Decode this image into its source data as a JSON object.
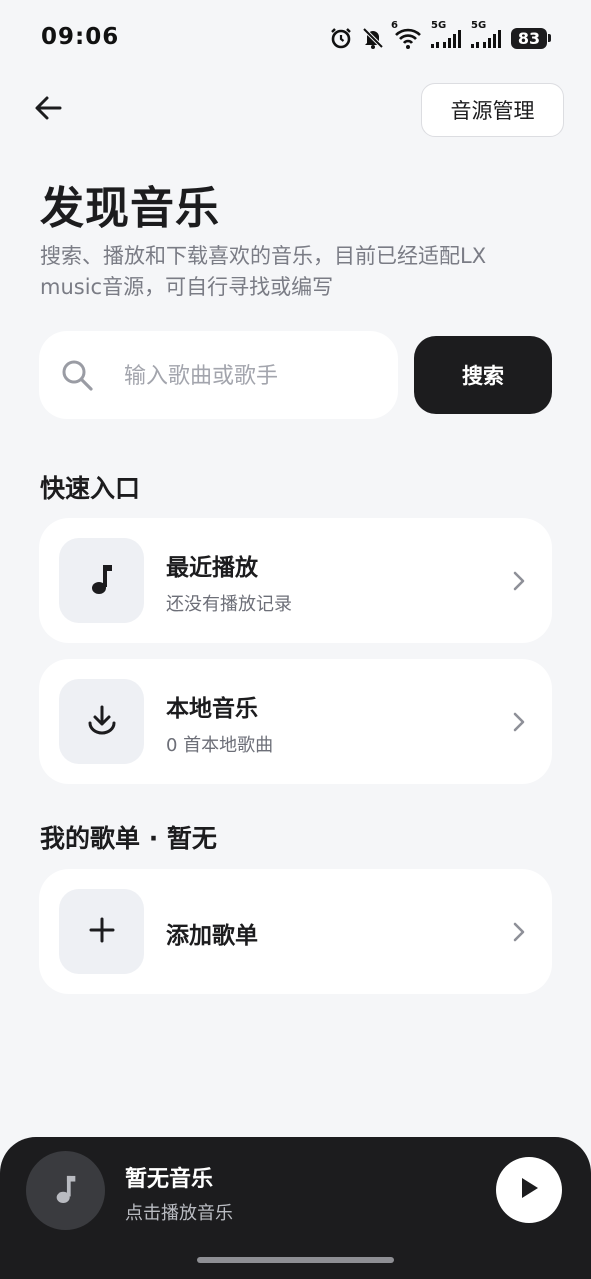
{
  "status_bar": {
    "time": "09:06",
    "battery": "83",
    "network_label_1": "5G",
    "network_label_2": "5G",
    "wifi_label": "6",
    "icons": [
      "alarm-icon",
      "bell-off-icon",
      "wifi-icon",
      "signal-icon",
      "signal-icon",
      "battery-icon"
    ]
  },
  "header": {
    "back_icon": "arrow-left-icon",
    "source_button_label": "音源管理"
  },
  "page": {
    "title": "发现音乐",
    "description": "搜索、播放和下载喜欢的音乐，目前已经适配LX music音源，可自行寻找或编写"
  },
  "search": {
    "placeholder": "输入歌曲或歌手",
    "value": "",
    "button_label": "搜索",
    "icon": "search-icon"
  },
  "quick_access": {
    "title": "快速入口",
    "items": [
      {
        "title": "最近播放",
        "subtitle": "还没有播放记录",
        "icon": "music-note-icon"
      },
      {
        "title": "本地音乐",
        "subtitle": "0 首本地歌曲",
        "icon": "download-icon"
      }
    ]
  },
  "playlists": {
    "title": "我的歌单 · 暂无",
    "add_label": "添加歌单",
    "add_icon": "plus-icon"
  },
  "player": {
    "title": "暂无音乐",
    "subtitle": "点击播放音乐",
    "cover_icon": "music-note-icon",
    "play_icon": "play-icon"
  },
  "colors": {
    "background": "#f5f6f8",
    "card": "#ffffff",
    "accent_dark": "#1c1c1e",
    "muted_text": "#7a7c85"
  }
}
